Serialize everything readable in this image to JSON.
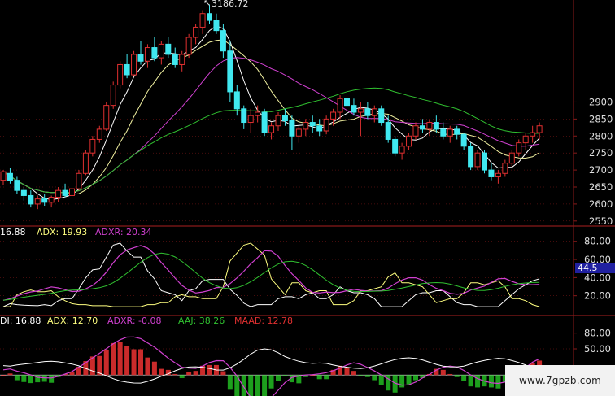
{
  "colors": {
    "background": "#000000",
    "grid": "#8a1a1a",
    "up_candle": "#e03030",
    "down_candle": "#40e8f0",
    "ma_short": "#ffffff",
    "ma_mid": "#f0f0a0",
    "ma_long": "#d040d0",
    "ma_longest": "#30c030",
    "pdi": "#ffffff",
    "mdi": "#ffff80",
    "adx": "#d040d0",
    "adxr": "#30c030",
    "aaj": "#e03030",
    "maad_green": "#20b020",
    "highlight_box": "#2020a0"
  },
  "price_panel": {
    "peak_label": "3186.72",
    "y_ticks": [
      "2900",
      "2850",
      "2800",
      "2750",
      "2700",
      "2650",
      "2600",
      "2550"
    ]
  },
  "dmi_panel": {
    "pdi_label": "16.88",
    "adx_label": "ADX: 19.93",
    "adxr_label": "ADXR: 20.34",
    "y_ticks": [
      "80.00",
      "60.00",
      "40.00",
      "20.00"
    ],
    "current_value_box": "44.5"
  },
  "dmi2_panel": {
    "pdi_label": "DI: 16.88",
    "adx_label": "ADX: 12.70",
    "adxr_label": "ADXR: -0.08",
    "aaj_label": "AAJ: 38.26",
    "maad_label": "MAAD: 12.78",
    "y_ticks": [
      "80.00",
      "50.00"
    ]
  },
  "watermark": "www.7gpzb.com",
  "chart_data": {
    "type": "candlestick",
    "ylim": [
      2540,
      3200
    ],
    "ohlc": [
      [
        2670,
        2700,
        2655,
        2695
      ],
      [
        2690,
        2705,
        2660,
        2670
      ],
      [
        2670,
        2680,
        2630,
        2640
      ],
      [
        2640,
        2650,
        2610,
        2625
      ],
      [
        2625,
        2640,
        2590,
        2600
      ],
      [
        2600,
        2625,
        2585,
        2615
      ],
      [
        2615,
        2630,
        2595,
        2605
      ],
      [
        2605,
        2625,
        2590,
        2620
      ],
      [
        2620,
        2650,
        2605,
        2640
      ],
      [
        2640,
        2660,
        2620,
        2625
      ],
      [
        2625,
        2650,
        2615,
        2645
      ],
      [
        2645,
        2700,
        2640,
        2690
      ],
      [
        2690,
        2760,
        2685,
        2750
      ],
      [
        2750,
        2800,
        2740,
        2790
      ],
      [
        2790,
        2830,
        2780,
        2820
      ],
      [
        2820,
        2900,
        2815,
        2890
      ],
      [
        2890,
        2960,
        2880,
        2950
      ],
      [
        2950,
        3020,
        2940,
        3010
      ],
      [
        3010,
        3040,
        2970,
        2980
      ],
      [
        2980,
        3050,
        2975,
        3040
      ],
      [
        3040,
        3080,
        3010,
        3020
      ],
      [
        3020,
        3070,
        3000,
        3060
      ],
      [
        3060,
        3090,
        3020,
        3030
      ],
      [
        3030,
        3080,
        3010,
        3070
      ],
      [
        3070,
        3090,
        3030,
        3040
      ],
      [
        3040,
        3060,
        3000,
        3010
      ],
      [
        3010,
        3050,
        2990,
        3040
      ],
      [
        3040,
        3100,
        3030,
        3090
      ],
      [
        3090,
        3130,
        3070,
        3120
      ],
      [
        3120,
        3170,
        3100,
        3160
      ],
      [
        3160,
        3187,
        3130,
        3140
      ],
      [
        3140,
        3160,
        3100,
        3110
      ],
      [
        3110,
        3130,
        3030,
        3050
      ],
      [
        3050,
        3080,
        2900,
        2930
      ],
      [
        2930,
        2950,
        2860,
        2880
      ],
      [
        2880,
        2890,
        2820,
        2840
      ],
      [
        2840,
        2880,
        2810,
        2860
      ],
      [
        2860,
        2890,
        2840,
        2870
      ],
      [
        2870,
        2880,
        2800,
        2810
      ],
      [
        2810,
        2840,
        2790,
        2830
      ],
      [
        2830,
        2870,
        2815,
        2860
      ],
      [
        2860,
        2880,
        2830,
        2845
      ],
      [
        2845,
        2860,
        2760,
        2800
      ],
      [
        2800,
        2830,
        2780,
        2820
      ],
      [
        2820,
        2850,
        2800,
        2840
      ],
      [
        2840,
        2860,
        2810,
        2830
      ],
      [
        2830,
        2850,
        2800,
        2815
      ],
      [
        2815,
        2860,
        2805,
        2850
      ],
      [
        2850,
        2880,
        2830,
        2870
      ],
      [
        2870,
        2920,
        2850,
        2910
      ],
      [
        2910,
        2920,
        2880,
        2890
      ],
      [
        2890,
        2910,
        2860,
        2870
      ],
      [
        2870,
        2900,
        2800,
        2880
      ],
      [
        2880,
        2900,
        2850,
        2860
      ],
      [
        2860,
        2890,
        2840,
        2880
      ],
      [
        2880,
        2890,
        2830,
        2840
      ],
      [
        2840,
        2860,
        2780,
        2790
      ],
      [
        2790,
        2800,
        2740,
        2750
      ],
      [
        2750,
        2780,
        2730,
        2770
      ],
      [
        2770,
        2810,
        2760,
        2800
      ],
      [
        2800,
        2840,
        2790,
        2830
      ],
      [
        2830,
        2850,
        2810,
        2820
      ],
      [
        2820,
        2850,
        2800,
        2840
      ],
      [
        2840,
        2860,
        2810,
        2820
      ],
      [
        2820,
        2840,
        2790,
        2800
      ],
      [
        2800,
        2830,
        2780,
        2820
      ],
      [
        2820,
        2830,
        2790,
        2805
      ],
      [
        2805,
        2810,
        2760,
        2770
      ],
      [
        2770,
        2780,
        2700,
        2710
      ],
      [
        2710,
        2760,
        2700,
        2750
      ],
      [
        2750,
        2760,
        2690,
        2700
      ],
      [
        2700,
        2720,
        2670,
        2680
      ],
      [
        2680,
        2700,
        2660,
        2690
      ],
      [
        2690,
        2730,
        2680,
        2720
      ],
      [
        2720,
        2760,
        2710,
        2750
      ],
      [
        2750,
        2790,
        2740,
        2780
      ],
      [
        2780,
        2810,
        2760,
        2800
      ],
      [
        2800,
        2830,
        2780,
        2810
      ],
      [
        2810,
        2840,
        2790,
        2830
      ]
    ]
  }
}
